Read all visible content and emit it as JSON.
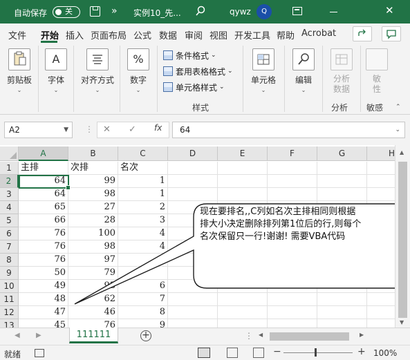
{
  "titlebar": {
    "autosave_label": "自动保存",
    "toggle_state": "关",
    "more": "»",
    "doc_title": "实例10_先...",
    "user_name": "qywz",
    "avatar_initial": "Q"
  },
  "menu": {
    "tabs": [
      "文件",
      "开始",
      "插入",
      "页面布局",
      "公式",
      "数据",
      "审阅",
      "视图",
      "开发工具",
      "帮助",
      "Acrobat"
    ],
    "active_tab": "开始"
  },
  "ribbon": {
    "paste_label": "剪贴板",
    "font_label": "字体",
    "align_label": "对齐方式",
    "number_label": "数字",
    "cond_format": "条件格式",
    "table_format": "套用表格格式",
    "cell_style": "单元格样式",
    "style_group": "样式",
    "cells_label": "单元格",
    "edit_label": "编辑",
    "analyze_label": "分析\n数据",
    "analyze_group": "分析",
    "sensitivity_label": "敏\n性",
    "sensitivity_group": "敏感",
    "font_icon_char": "A",
    "number_icon_char": "%"
  },
  "formula_bar": {
    "name_box": "A2",
    "value": "64",
    "fx": "fx"
  },
  "grid": {
    "columns": [
      "A",
      "B",
      "C",
      "D",
      "E",
      "F",
      "G",
      "H"
    ],
    "selected_column": "A",
    "selected_row": "2",
    "rows": [
      {
        "n": "1",
        "a": "主排",
        "b": "次排",
        "c": "名次"
      },
      {
        "n": "2",
        "a": "64",
        "b": "99",
        "c": "1"
      },
      {
        "n": "3",
        "a": "64",
        "b": "98",
        "c": "1"
      },
      {
        "n": "4",
        "a": "65",
        "b": "27",
        "c": "2"
      },
      {
        "n": "5",
        "a": "66",
        "b": "28",
        "c": "3"
      },
      {
        "n": "6",
        "a": "76",
        "b": "100",
        "c": "4"
      },
      {
        "n": "7",
        "a": "76",
        "b": "98",
        "c": "4"
      },
      {
        "n": "8",
        "a": "76",
        "b": "97",
        "c": "4"
      },
      {
        "n": "9",
        "a": "50",
        "b": "79",
        "c": ""
      },
      {
        "n": "10",
        "a": "49",
        "b": "93",
        "c": "6"
      },
      {
        "n": "11",
        "a": "48",
        "b": "62",
        "c": "7"
      },
      {
        "n": "12",
        "a": "47",
        "b": "46",
        "c": "8"
      },
      {
        "n": "13",
        "a": "45",
        "b": "76",
        "c": "9"
      }
    ]
  },
  "callout": {
    "text": "现在要排名,,C列如名次主排相同则根据\n排大小决定删除排列第1位后的行,则每个\n名次保留只一行!谢谢! 需要VBA代码"
  },
  "sheets": {
    "tabs": [
      "111111"
    ],
    "active": "111111",
    "add": "+"
  },
  "status": {
    "text": "就绪",
    "zoom": "100%"
  }
}
